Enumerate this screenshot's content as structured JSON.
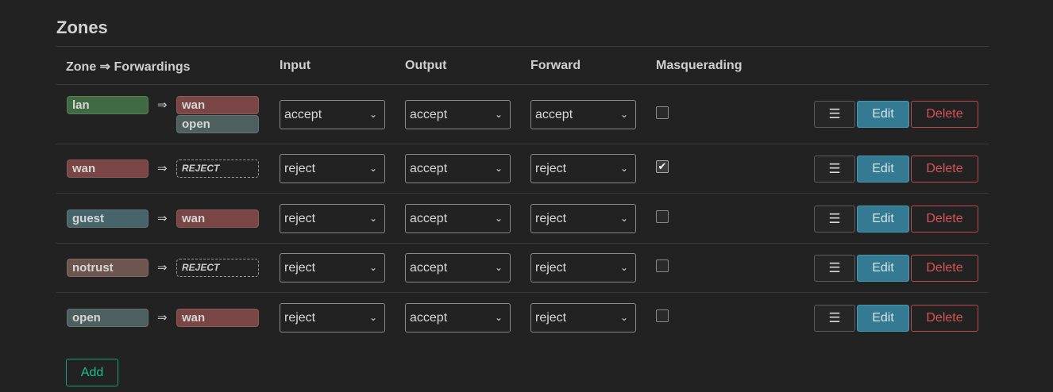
{
  "title": "Zones",
  "headers": {
    "zone": "Zone ⇒ Forwardings",
    "input": "Input",
    "output": "Output",
    "forward": "Forward",
    "masq": "Masquerading"
  },
  "arrow": "⇒",
  "chevron": "⌄",
  "zones": [
    {
      "name": "lan",
      "color": "#3f6a43",
      "forwards": [
        {
          "name": "wan",
          "color": "#7a4545"
        },
        {
          "name": "open",
          "color": "#4e5f5f"
        }
      ],
      "input": "accept",
      "output": "accept",
      "forward": "accept",
      "masq": false
    },
    {
      "name": "wan",
      "color": "#7a4545",
      "reject_label": "REJECT",
      "input": "reject",
      "output": "accept",
      "forward": "reject",
      "masq": true
    },
    {
      "name": "guest",
      "color": "#46646a",
      "forwards": [
        {
          "name": "wan",
          "color": "#7a4545"
        }
      ],
      "input": "reject",
      "output": "accept",
      "forward": "reject",
      "masq": false
    },
    {
      "name": "notrust",
      "color": "#6d5550",
      "reject_label": "REJECT",
      "input": "reject",
      "output": "accept",
      "forward": "reject",
      "masq": false
    },
    {
      "name": "open",
      "color": "#4e5f5f",
      "forwards": [
        {
          "name": "wan",
          "color": "#7a4545"
        }
      ],
      "input": "reject",
      "output": "accept",
      "forward": "reject",
      "masq": false
    }
  ],
  "buttons": {
    "menu": "☰",
    "edit": "Edit",
    "delete": "Delete",
    "add": "Add",
    "checkmark": "✔"
  },
  "colors": {
    "edit_bg": "#347a92",
    "delete_border": "#c04848",
    "add_border": "#13a07a"
  }
}
